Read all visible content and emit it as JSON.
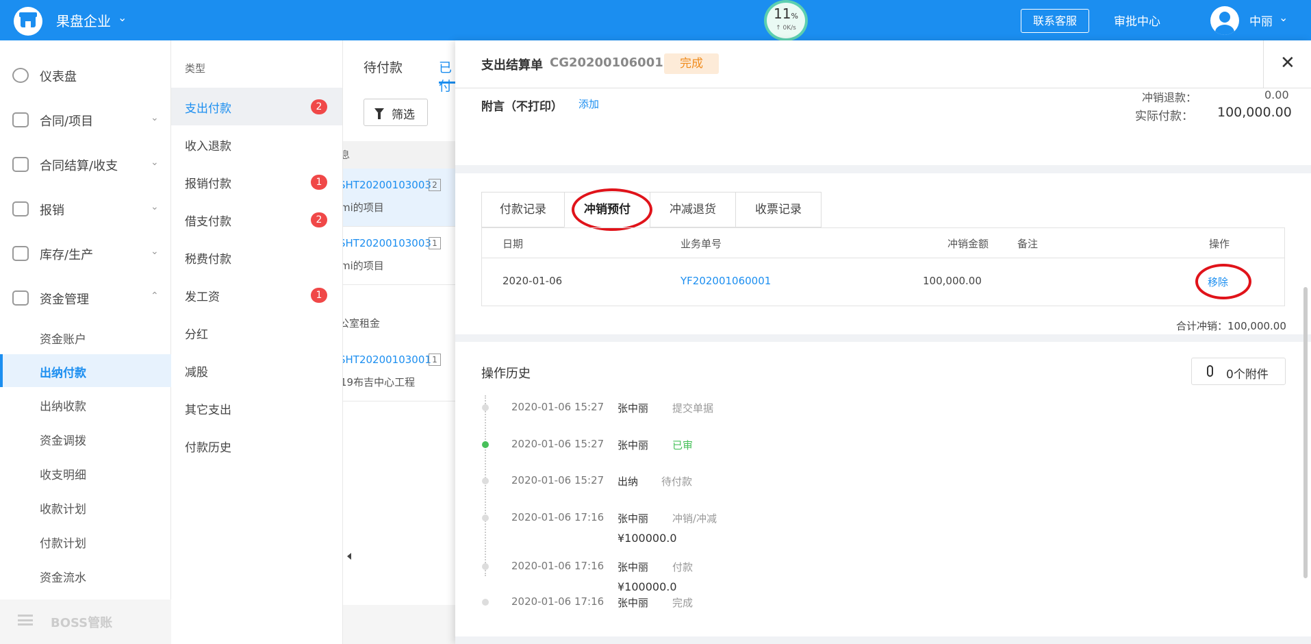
{
  "header": {
    "company": "果盘企业",
    "netspeed": {
      "percent": "11",
      "percent_unit": "%",
      "rate": "↑ 0K/s"
    },
    "service_label": "联系客服",
    "approval_label": "审批中心",
    "username": "中丽"
  },
  "sidebar": {
    "items": [
      {
        "label": "仪表盘"
      },
      {
        "label": "合同/项目"
      },
      {
        "label": "合同结算/收支"
      },
      {
        "label": "报销"
      },
      {
        "label": "库存/生产"
      },
      {
        "label": "资金管理"
      }
    ],
    "sub_items": [
      "资金账户",
      "出纳付款",
      "出纳收款",
      "资金调拨",
      "收支明细",
      "收款计划",
      "付款计划",
      "资金流水"
    ],
    "active_sub": "出纳付款",
    "footer": "BOSS管账"
  },
  "types": {
    "title": "类型",
    "items": [
      {
        "label": "支出付款",
        "badge": "2"
      },
      {
        "label": "收入退款",
        "badge": ""
      },
      {
        "label": "报销付款",
        "badge": "1"
      },
      {
        "label": "借支付款",
        "badge": "2"
      },
      {
        "label": "税费付款",
        "badge": ""
      },
      {
        "label": "发工资",
        "badge": "1"
      },
      {
        "label": "分红",
        "badge": ""
      },
      {
        "label": "减股",
        "badge": ""
      },
      {
        "label": "其它支出",
        "badge": ""
      },
      {
        "label": "付款历史",
        "badge": ""
      }
    ]
  },
  "list": {
    "tabs": [
      "待付款",
      "已付"
    ],
    "filter_label": "筛选",
    "head": "息",
    "records": [
      {
        "no": "SHT20200103003",
        "count": "2",
        "name": "mi的项目"
      },
      {
        "no": "SHT20200103003",
        "count": "1",
        "name": "mi的项目"
      },
      {
        "no": "SHT20200103001",
        "count": "1",
        "name": "19布吉中心工程"
      }
    ],
    "plain_item": "公室租金"
  },
  "detail": {
    "title": "支出结算单",
    "number": "CG20200106001",
    "status": "完成",
    "close": "✕",
    "note_label": "附言（不打印）",
    "note_add": "添加",
    "offset_refund_label": "冲销退款：",
    "offset_refund_value": "0.00",
    "actual_paid_label": "实际付款：",
    "actual_paid_value": "100,000.00",
    "tabs": [
      "付款记录",
      "冲销预付",
      "冲减退货",
      "收票记录"
    ],
    "active_tab": "冲销预付",
    "table": {
      "headers": [
        "日期",
        "业务单号",
        "冲销金额",
        "备注",
        "操作"
      ],
      "rows": [
        {
          "date": "2020-01-06",
          "business_no": "YF202001060001",
          "amount": "100,000.00",
          "note": "",
          "action": "移除"
        }
      ]
    },
    "total_offset": "合计冲销：100,000.00",
    "history_title": "操作历史",
    "attachments_label": "0个附件",
    "history": [
      {
        "time": "2020-01-06 15:27",
        "who": "张中丽",
        "action": "提交单据",
        "amount": ""
      },
      {
        "time": "2020-01-06 15:27",
        "who": "张中丽",
        "action": "已审",
        "amount": ""
      },
      {
        "time": "2020-01-06 15:27",
        "who": "出纳",
        "action": "待付款",
        "amount": ""
      },
      {
        "time": "2020-01-06 17:16",
        "who": "张中丽",
        "action": "冲销/冲减",
        "amount": "¥100000.0"
      },
      {
        "time": "2020-01-06 17:16",
        "who": "张中丽",
        "action": "付款",
        "amount": "¥100000.0"
      },
      {
        "time": "2020-01-06 17:16",
        "who": "张中丽",
        "action": "完成",
        "amount": ""
      }
    ]
  },
  "colors": {
    "brand": "#1b8ef0",
    "badge": "#f04848",
    "annotation": "#e0131a",
    "success": "#47c05a",
    "status": "#f08c1e"
  }
}
